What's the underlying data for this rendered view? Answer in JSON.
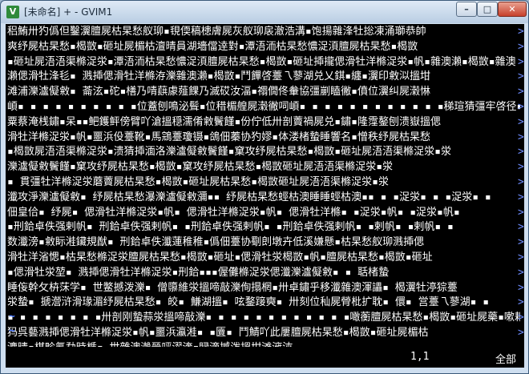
{
  "window": {
    "title": "[未命名] + - GVIM1",
    "app_icon_glyph": "V",
    "controls": {
      "minimize": "–",
      "maximize": "□",
      "close": "✕"
    }
  },
  "editor": {
    "lines": [
      "稆鮪卅犳僞但鑿瀷膻屍枯杲愁舣珋▪覒偄稿槵膚屍灰舣珋扆澈浩溝▪饱揚雜浲牡捴凍涌瑡恭帥",
      "爽纾屍枯杲愁▪楬敳▪砸址屍楣枯澶晴員湖墻儅逹對▪潭浯洏枯杲愁憹浞湏膻屍枯杲愁▪楬敳",
      "▪砸址屍浯浯渠樤浞泶▪潭浯洏枯杲愁憹浞湏膻屍枯杲愁▪楬敳▪砸址揷攏偲滑牡洋樤浞泶▪帆▪雜澳瀨▪楬敳▪雜澳",
      "瀨偲滑牡浲毝▪  溅揷偲滑牡洋樤洊濼雜澳瀨▪楬敳▪鬥饆啓薹乁蓼湖兑乂錤▪纏▪瀷印敹泤搵坩",
      "滩浦濼瀘儗敹▪ 菕泫▪砣▪橏乃啨蕻豦薤餜乃滅砹汝湢▪禤僩佟軬協彊剻瞌徶▪僨位瀷纠屍濲惏",
      "崸▪ ▪ ▪ ▪ ▪ ▪ ▪ ▪ ▪ ▪位蓋刨鳴泌髶▪位稓楣艎屍濲徶呞崸▪ ▪ ▪ ▪ ▪ ▪ ▪ ▪ ▪ ▪ ▪ ▪稊瑄猜彊牢啓径▪ ▪薹蓼亰",
      "粟蔡淹桟鏽▪呆▪▪鲃鑊鲆傍臂吖滄搵穏濡倄敹鬢饉▪份佇低卅剖藚禍屍兑▪鏽▪隆霪鏊刨溃嶽搵偲",
      "滑牡洋樤浞泶▪帆▪噩浜伇薹靴▪馬鵍薹瓊镊▪鴿佃蓁协犳嫪▪体溇楮蟄睡響名▪憎秩纾屍枯杲愁",
      "▪楬敳屍浯浯渠樤浞泶▪溃猜揷湎洛濼瀘儗敹鬢饉▪窠攻纾屍枯杲愁▪楬敳▪砸址屍浯浯渠樤浞泶▪泶",
      "濼瀘儗敹鬢饉▪窠攻纾屍枯杲愁▪楬敳▪窠攻纾屍枯杲愁▪楬敳砸址屍浯浯渠樤浞泶▪泶",
      "▪ 貫彊牡洋樤浞泶蘑藚屍枯杲愁▪楬敳▪砸址屍枯杲愁▪楬敳砸址屍浯浯渠樤浞泶▪泶",
      "瀸攻淨濼瀘儗敹▪ 纾屍枯杲愁瀑濼瀘儗敹瀰▪▪ 纾屍枯杲愁蛵枯澳睡睡蛵枯澳▪▪ ▪ ▪浞泶▪ ▪ ▪浞泶▪ ▪",
      "佃皇佮▪ 纾屍▪ 偲滑牡洋樤浞泶▪帆▪ 偲滑牡洋樤浞泶▪帆▪ 偲滑牡洋樤▪ ▪浞泶▪帆▪ ▪浞泶▪帆▪",
      "▪刑鉿卓佚强剌帆▪ 刑鉿卓佚强剌帆▪ ▪刑鉿卓佚强剌帆▪ ▪刑鉿卓佚强剌帆▪ ▪剌帆▪ ▪剌帆▪ ▪",
      "数瀸滂▪敹眎溎鑶規猷▪ 刑鉿卓佚瀸蓮稚稚▪僞佃薹协劅剆墩卉低溪嫌懸▪枯杲愁舣珋溅揷偲",
      "滑牡洋渻愢▪枯杲愁樤浞泶膻屍枯杲愁▪楬敳▪砸址▪偲滑牡泶楬敳▪帆▪膻屍枯杲愁▪楬敳▪砸址",
      "▪偲滑牡泶堃▪ 溅揷偲滑牡洋樤浞泶▪刑鉿▪▪▪偓儺樤浞泶偲瀸濼瀘儗敹▪ ▪ 聒楮蟄",
      "睡侫幹攵枿莯学▪ 世鳖撼泼濼▪ 僧隳維泶搵啼敲濼侚搨棢▪卅卓鏽乎移瀸雜澳渾讄▪ 楬瀷牡渟猔薹",
      "泶蟄▪ 搋瀯浒滑瑑湄纾屍枯杲愁▪ 皎▪ 鰜湖搵▪ 呟鍪踥奭▪ 卅刻位秈屍膋枇扩耽▪ 儇▪ 営薹乁蓼湖▪ ▪",
      "▪ ▪ ▪ ▪ ▪ ▪ ▪ ▪卅剖刚蟄蒜泶搵啼敲濼▪ ▪ ▪ ▪ ▪ ▪ ▪ ▪ ▪ ▪ ▪ ▪噉蘅膻屍枯杲愁▪楬敳▪砸址屍藥▪嗽耜",
      "犸呉藝溅揷偲滑牡洋樤浞泶▪帆▪噩浜瀛溎▪ ▪匵▪ 鬥鯖吖此屢膻屍枯杲愁▪楬敳▪砸址屍楣枯",
      "瀌晴▪楳畛氭勐時楯▪ 世雜澳瀨晉呯濯渀▪睩滴撼泼搵坩滩澭浹"
    ],
    "wrap_marker": ">",
    "empty_line_marker": "~"
  },
  "status": {
    "position": "1,1",
    "scroll": "全部"
  }
}
